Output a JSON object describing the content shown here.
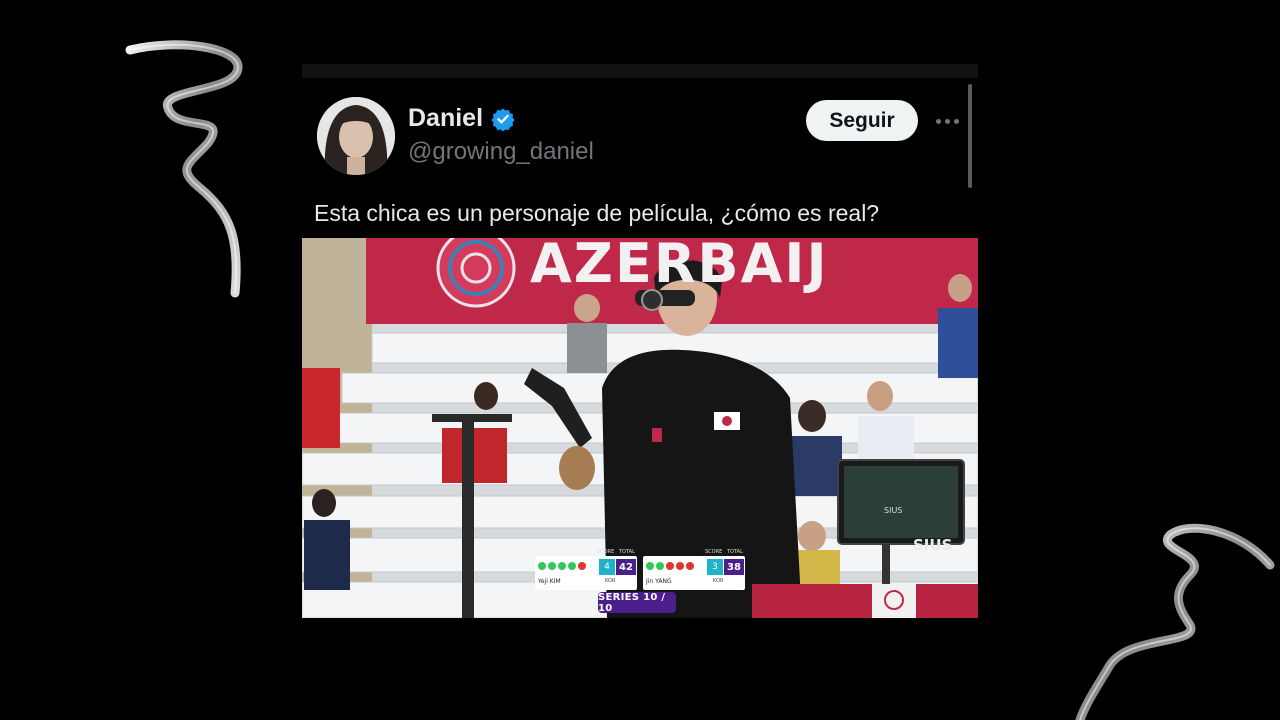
{
  "post": {
    "author_name": "Daniel",
    "handle": "@growing_daniel",
    "verified": true,
    "follow_label": "Seguir",
    "more_icon": "more-horizontal-icon",
    "text": "Esta chica es un personaje de película, ¿cómo es real?"
  },
  "media": {
    "banner_text": "AZERBAIJ",
    "scoreboard": {
      "left": {
        "name": "Yeji KIM",
        "country": "KOR",
        "series_score": "4",
        "total": "42",
        "label_score": "SCORE",
        "label_total": "TOTAL",
        "dots": [
          "#35c759",
          "#35c759",
          "#35c759",
          "#35c759",
          "#e0342f"
        ]
      },
      "right": {
        "name": "Jin YANG",
        "country": "KOR",
        "series_score": "3",
        "total": "38",
        "label_score": "SCORE",
        "label_total": "TOTAL",
        "dots": [
          "#35c759",
          "#35c759",
          "#e0342f",
          "#e0342f",
          "#e0342f"
        ]
      }
    },
    "series_label": "SERIES 10 / 10",
    "brand": "SIUS",
    "monitor_text": "SIUS"
  },
  "colors": {
    "background": "#000000",
    "follow_button_bg": "#eff3f4",
    "verified_blue": "#1d9bf0",
    "banner_red": "#c0284a",
    "score_purple": "#4a1f8c",
    "score_cyan": "#20b2c8"
  }
}
